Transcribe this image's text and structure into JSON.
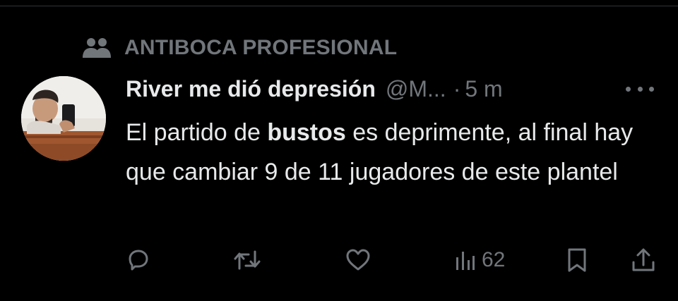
{
  "community": {
    "label": "ANTIBOCA PROFESIONAL",
    "icon": "community-people-icon"
  },
  "tweet": {
    "author_name": "River me dió depresión",
    "handle": "@M...",
    "separator": "·",
    "time": "5 m",
    "avatar_icon": "user-avatar",
    "more_icon": "more-dots-icon",
    "text_part1": "El partido de ",
    "text_bold": "bustos",
    "text_part2": " es deprimente, al final hay que cambiar 9 de 11 jugadores de este plantel"
  },
  "actions": {
    "reply_icon": "reply-icon",
    "retweet_icon": "retweet-icon",
    "like_icon": "heart-icon",
    "views_icon": "views-chart-icon",
    "views_count": "62",
    "bookmark_icon": "bookmark-icon",
    "share_icon": "share-icon"
  },
  "colors": {
    "background": "#000000",
    "text": "#e7e9ea",
    "muted": "#71767b"
  }
}
